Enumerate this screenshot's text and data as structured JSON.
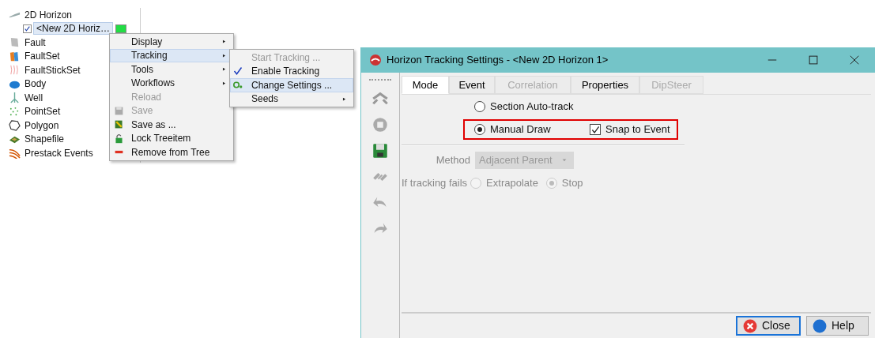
{
  "tree": {
    "items": [
      {
        "label": "2D Horizon",
        "children": [
          {
            "label": "<New 2D Horiz…",
            "checked": true,
            "selected": true
          }
        ]
      },
      {
        "label": "Fault"
      },
      {
        "label": "FaultSet"
      },
      {
        "label": "FaultStickSet"
      },
      {
        "label": "Body"
      },
      {
        "label": "Well"
      },
      {
        "label": "PointSet"
      },
      {
        "label": "Polygon"
      },
      {
        "label": "Shapefile"
      },
      {
        "label": "Prestack Events"
      }
    ]
  },
  "context_menu": {
    "items": [
      {
        "label": "Display",
        "disabled": false,
        "submenu": true,
        "selected": false
      },
      {
        "label": "Tracking",
        "disabled": false,
        "submenu": true,
        "selected": true
      },
      {
        "label": "Tools",
        "disabled": false,
        "submenu": true,
        "selected": false
      },
      {
        "label": "Workflows",
        "disabled": false,
        "submenu": true,
        "selected": false
      },
      {
        "label": "Reload",
        "disabled": true,
        "submenu": false,
        "selected": false
      },
      {
        "label": "Save",
        "disabled": true,
        "submenu": false,
        "selected": false
      },
      {
        "label": "Save as ...",
        "disabled": false,
        "submenu": false,
        "selected": false
      },
      {
        "label": "Lock Treeitem",
        "disabled": false,
        "submenu": false,
        "selected": false
      },
      {
        "label": "Remove from Tree",
        "disabled": false,
        "submenu": false,
        "selected": false
      }
    ]
  },
  "tracking_submenu": {
    "items": [
      {
        "label": "Start Tracking ...",
        "disabled": true,
        "checked": false,
        "submenu": false,
        "selected": false
      },
      {
        "label": "Enable Tracking",
        "disabled": false,
        "checked": true,
        "submenu": false,
        "selected": false
      },
      {
        "label": "Change Settings ...",
        "disabled": false,
        "checked": false,
        "submenu": false,
        "selected": true
      },
      {
        "label": "Seeds",
        "disabled": false,
        "checked": false,
        "submenu": true,
        "selected": false
      }
    ]
  },
  "dialog": {
    "title": "Horizon Tracking Settings - <New 2D Horizon 1>",
    "tabs": [
      {
        "label": "Mode",
        "selected": true,
        "disabled": false
      },
      {
        "label": "Event",
        "selected": false,
        "disabled": false
      },
      {
        "label": "Correlation",
        "selected": false,
        "disabled": true
      },
      {
        "label": "Properties",
        "selected": false,
        "disabled": false
      },
      {
        "label": "DipSteer",
        "selected": false,
        "disabled": true
      }
    ],
    "mode_options": [
      {
        "label": "Section Auto-track",
        "selected": false
      },
      {
        "label": "Manual Draw",
        "selected": true
      }
    ],
    "snap_to_event": {
      "label": "Snap to Event",
      "checked": true
    },
    "method": {
      "label": "Method",
      "value": "Adjacent Parent",
      "disabled": true
    },
    "if_tracking_fails": {
      "label": "If tracking fails",
      "options": [
        {
          "label": "Extrapolate",
          "selected": false
        },
        {
          "label": "Stop",
          "selected": true
        }
      ],
      "disabled": true
    },
    "buttons": [
      {
        "label": "Close",
        "focused": true
      },
      {
        "label": "Help",
        "focused": false
      }
    ]
  }
}
